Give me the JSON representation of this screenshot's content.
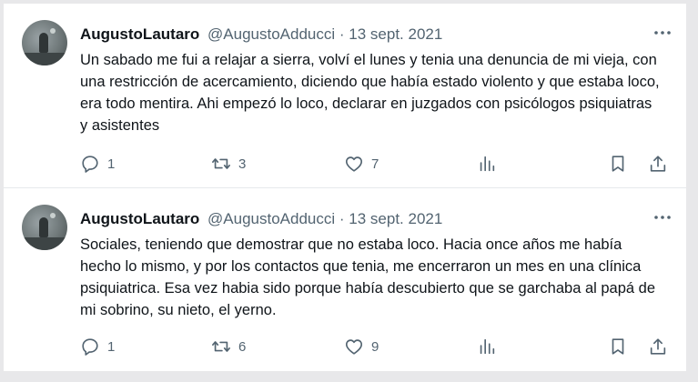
{
  "tweets": [
    {
      "author_name": "AugustoLautaro",
      "handle": "@AugustoAdducci",
      "separator": "·",
      "date": "13 sept. 2021",
      "text": "Un sabado me fui a relajar a sierra, volví el lunes y tenia una denuncia de mi vieja, con una restricción de acercamiento, diciendo que había estado violento y que estaba loco, era todo mentira. Ahi empezó lo loco, declarar en juzgados con psicólogos psiquiatras y asistentes",
      "reply_count": "1",
      "retweet_count": "3",
      "like_count": "7"
    },
    {
      "author_name": "AugustoLautaro",
      "handle": "@AugustoAdducci",
      "separator": "·",
      "date": "13 sept. 2021",
      "text": "Sociales, teniendo que demostrar que no estaba loco. Hacia once años me había hecho lo mismo, y por los contactos que tenia, me encerraron un mes en una clínica psiquiatrica. Esa vez habia sido porque había descubierto que se garchaba al papá de mi sobrino, su nieto, el yerno.",
      "reply_count": "1",
      "retweet_count": "6",
      "like_count": "9"
    }
  ],
  "icons": {
    "avatar": "avatar-photo",
    "more": "more-horizontal-icon",
    "reply": "reply-icon",
    "retweet": "retweet-icon",
    "like": "heart-icon",
    "views": "views-chart-icon",
    "bookmark": "bookmark-icon",
    "share": "share-icon"
  },
  "colors": {
    "text_primary": "#0f1419",
    "text_secondary": "#536471",
    "background": "#ffffff"
  }
}
